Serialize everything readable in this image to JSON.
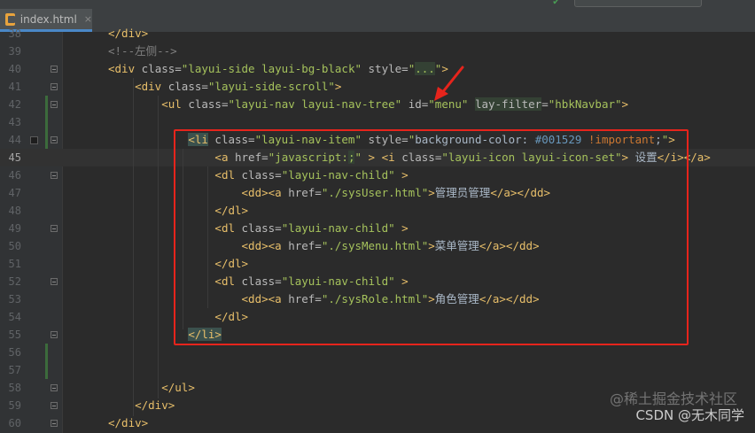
{
  "tab": {
    "filename": "index.html",
    "close": "×"
  },
  "top": {
    "check": "✔"
  },
  "lines": [
    {
      "n": "38",
      "html": "<span class='tag'>&lt;/div&gt;</span>"
    },
    {
      "n": "39",
      "html": "<span class='cmt'>&lt;!--左侧--&gt;</span>"
    },
    {
      "n": "40",
      "html": "<span class='tag'>&lt;div </span><span class='attr'>class=</span><span class='val'>\"layui-side layui-bg-black\"</span> <span class='attr'>style=</span><span class='val'>\"<span class='hl'>...</span>\"</span><span class='tag'>&gt;</span>"
    },
    {
      "n": "41",
      "html": "    <span class='tag'>&lt;div </span><span class='attr'>class=</span><span class='val'>\"layui-side-scroll\"</span><span class='tag'>&gt;</span>"
    },
    {
      "n": "42",
      "html": "        <span class='tag'>&lt;ul </span><span class='attr'>class=</span><span class='val'>\"layui-nav layui-nav-tree\"</span> <span class='attr'>id=</span><span class='val'>\"menu\"</span> <span class='attr hl'>lay-filter</span><span class='attr'>=</span><span class='val'>\"hbkNavbar\"</span><span class='tag'>&gt;</span>"
    },
    {
      "n": "43",
      "html": ""
    },
    {
      "n": "44",
      "html": "            <span class='tag match'>&lt;li</span><span class='tag'> </span><span class='attr'>class=</span><span class='val'>\"layui-nav-item\"</span> <span class='attr'>style=</span><span class='val'>\"</span><span class='txt'>background-color: </span><span class='blue'>#001529</span> <span class='kw'>!important</span><span class='txt'>;</span><span class='val'>\"</span><span class='tag'>&gt;</span>"
    },
    {
      "n": "45",
      "html": "                <span class='tag'>&lt;a </span><span class='attr'>href=</span><span class='val'>\"javascript:<span class='hl'>;</span>\"</span> <span class='tag'>&gt;</span> <span class='tag'>&lt;i </span><span class='attr'>class=</span><span class='val'>\"layui-icon layui-icon-set\"</span><span class='tag'>&gt;</span> <span class='txt'>设置</span><span class='tag'>&lt;/i&gt;&lt;/a&gt;</span>"
    },
    {
      "n": "46",
      "html": "                <span class='tag'>&lt;dl </span><span class='attr'>class=</span><span class='val'>\"layui-nav-child\"</span> <span class='tag'>&gt;</span>"
    },
    {
      "n": "47",
      "html": "                    <span class='tag'>&lt;dd&gt;&lt;a </span><span class='attr'>href=</span><span class='val'>\"./sysUser.html\"</span><span class='tag'>&gt;</span><span class='txt'>管理员管理</span><span class='tag'>&lt;/a&gt;&lt;/dd&gt;</span>"
    },
    {
      "n": "48",
      "html": "                <span class='tag'>&lt;/dl&gt;</span>"
    },
    {
      "n": "49",
      "html": "                <span class='tag'>&lt;dl </span><span class='attr'>class=</span><span class='val'>\"layui-nav-child\"</span> <span class='tag'>&gt;</span>"
    },
    {
      "n": "50",
      "html": "                    <span class='tag'>&lt;dd&gt;&lt;a </span><span class='attr'>href=</span><span class='val'>\"./sysMenu.html\"</span><span class='tag'>&gt;</span><span class='txt'>菜单管理</span><span class='tag'>&lt;/a&gt;&lt;/dd&gt;</span>"
    },
    {
      "n": "51",
      "html": "                <span class='tag'>&lt;/dl&gt;</span>"
    },
    {
      "n": "52",
      "html": "                <span class='tag'>&lt;dl </span><span class='attr'>class=</span><span class='val'>\"layui-nav-child\"</span> <span class='tag'>&gt;</span>"
    },
    {
      "n": "53",
      "html": "                    <span class='tag'>&lt;dd&gt;&lt;a </span><span class='attr'>href=</span><span class='val'>\"./sysRole.html\"</span><span class='tag'>&gt;</span><span class='txt'>角色管理</span><span class='tag'>&lt;/a&gt;&lt;/dd&gt;</span>"
    },
    {
      "n": "54",
      "html": "                <span class='tag'>&lt;/dl&gt;</span>"
    },
    {
      "n": "55",
      "html": "            <span class='tag match'>&lt;/li&gt;</span>"
    },
    {
      "n": "56",
      "html": ""
    },
    {
      "n": "57",
      "html": ""
    },
    {
      "n": "58",
      "html": "        <span class='tag'>&lt;/ul&gt;</span>"
    },
    {
      "n": "59",
      "html": "    <span class='tag'>&lt;/div&gt;</span>"
    },
    {
      "n": "60",
      "html": "<span class='tag'>&lt;/div&gt;</span>"
    }
  ],
  "current_line": "45",
  "watermark": {
    "line1": "@稀土掘金技术社区",
    "line2": "CSDN @无木同学"
  },
  "colors": {
    "annotation": "#e6241c",
    "tab_accent": "#4a88c7"
  }
}
